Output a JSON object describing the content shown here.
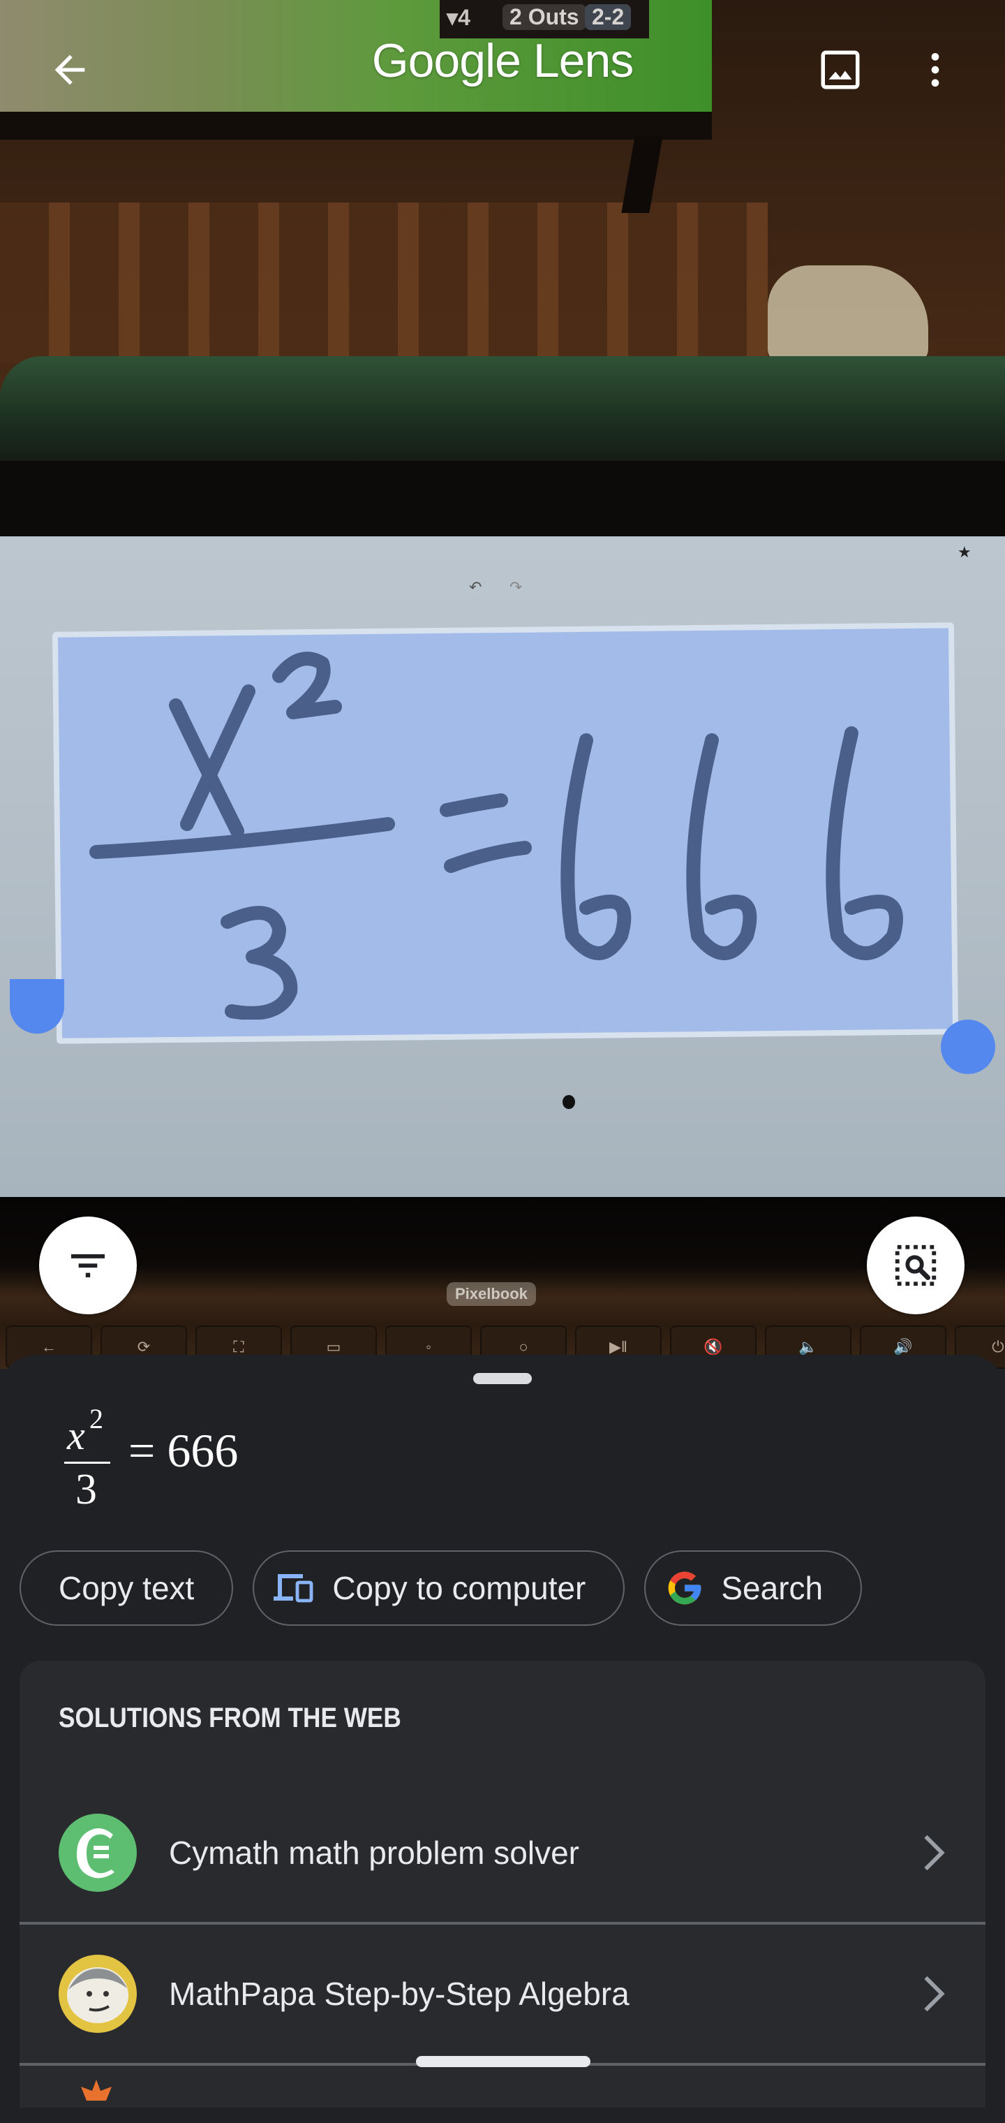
{
  "app": {
    "title": "Google Lens",
    "accent_color": "#5588ee"
  },
  "topbar": {
    "back_icon": "arrow-back-icon",
    "gallery_icon": "image-gallery-icon",
    "more_icon": "more-vert-icon"
  },
  "camera": {
    "scoreboard": {
      "inning": "▾4",
      "outs": "2 Outs",
      "count": "2-2"
    },
    "laptop_label": "Pixelbook",
    "keys": [
      "←",
      "⟳",
      "⛶",
      "▭",
      "◦",
      "○",
      "▶‖",
      "🔇",
      "🔈",
      "🔊",
      "⏻"
    ],
    "handwritten_equation": "x²/3 = 666",
    "selection_color": "#a2bbe8"
  },
  "fabs": {
    "filter_icon": "filter-icon",
    "search_region_icon": "search-region-icon"
  },
  "result": {
    "formula": {
      "numerator_var": "x",
      "numerator_exp": "2",
      "denominator": "3",
      "rhs": "= 666"
    },
    "actions": [
      {
        "label": "Copy text",
        "icon": null
      },
      {
        "label": "Copy to computer",
        "icon": "devices-icon"
      },
      {
        "label": "Search",
        "icon": "google-g-icon"
      }
    ],
    "solutions": {
      "heading": "SOLUTIONS FROM THE WEB",
      "items": [
        {
          "label": "Cymath math problem solver",
          "icon": "cymath-logo-icon",
          "color": "#5dbe72"
        },
        {
          "label": "MathPapa Step-by-Step Algebra",
          "icon": "mathpapa-logo-icon",
          "color": "#e3c342"
        }
      ]
    }
  }
}
